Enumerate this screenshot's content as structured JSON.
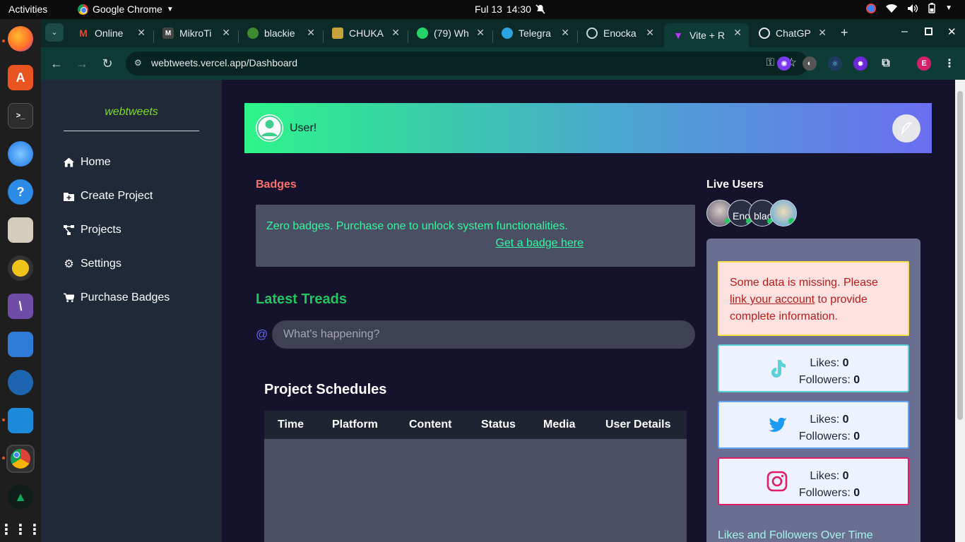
{
  "os_bar": {
    "activities": "Activities",
    "app_name": "Google Chrome",
    "date": "Ful 13",
    "time": "14:30"
  },
  "dock": {
    "items": [
      "firefox-icon",
      "software-center-icon",
      "terminal-icon",
      "thunderbird-icon",
      "help-icon",
      "files-icon",
      "rhythmbox-icon",
      "inkscape-icon",
      "libreoffice-writer-icon",
      "mysql-workbench-icon",
      "vscode-icon",
      "chrome-icon",
      "mongodb-compass-icon",
      "show-apps-icon"
    ]
  },
  "tabs": [
    {
      "label": "Online",
      "icon": "gmail-icon"
    },
    {
      "label": "MikroTi",
      "icon": "mikrotik-icon"
    },
    {
      "label": "blackie",
      "icon": "blackie-icon"
    },
    {
      "label": "CHUKA",
      "icon": "chuka-icon"
    },
    {
      "label": "(79) Wh",
      "icon": "whatsapp-icon"
    },
    {
      "label": "Telegra",
      "icon": "telegram-icon"
    },
    {
      "label": "Enocka",
      "icon": "globe-icon"
    },
    {
      "label": "Vite + R",
      "icon": "vite-icon"
    },
    {
      "label": "ChatGP",
      "icon": "openai-icon"
    }
  ],
  "address_bar": {
    "url": "webtweets.vercel.app/Dashboard",
    "profile_initial": "E"
  },
  "sidebar": {
    "brand": "webtweets",
    "items": [
      {
        "label": "Home",
        "icon": "home-icon"
      },
      {
        "label": "Create Project",
        "icon": "folder-plus-icon"
      },
      {
        "label": "Projects",
        "icon": "project-diagram-icon"
      },
      {
        "label": "Settings",
        "icon": "gear-icon"
      },
      {
        "label": "Purchase Badges",
        "icon": "cart-icon"
      }
    ]
  },
  "banner": {
    "username": "User!"
  },
  "badges": {
    "heading": "Badges",
    "message": "Zero badges. Purchase one to unlock system functionalities.",
    "link": "Get a badge here"
  },
  "treads": {
    "heading": "Latest Treads",
    "at": "@",
    "placeholder": "What's happening?"
  },
  "schedules": {
    "heading": "Project Schedules",
    "columns": [
      "Time",
      "Platform",
      "Content",
      "Status",
      "Media",
      "User Details"
    ],
    "rows": []
  },
  "live_users": {
    "heading": "Live Users",
    "users": [
      "",
      "Enock",
      "black",
      ""
    ]
  },
  "warning": {
    "prefix": "Some data is missing. Please ",
    "link": "link your account",
    "suffix": " to provide complete information."
  },
  "stats": [
    {
      "platform": "tiktok-icon",
      "likes_label": "Likes:",
      "likes": "0",
      "followers_label": "Followers:",
      "followers": "0",
      "border": "#5ad1d6"
    },
    {
      "platform": "twitter-icon",
      "likes_label": "Likes:",
      "likes": "0",
      "followers_label": "Followers:",
      "followers": "0",
      "border": "#60a5fa"
    },
    {
      "platform": "instagram-icon",
      "likes_label": "Likes:",
      "likes": "0",
      "followers_label": "Followers:",
      "followers": "0",
      "border": "#e11d68"
    }
  ],
  "chart_section": {
    "title": "Likes and Followers Over Time"
  },
  "colors": {
    "brand_green": "#7ddc1f",
    "badge_red": "#f87171",
    "treads_green": "#22c55e",
    "badge_text": "#34f5a0"
  }
}
